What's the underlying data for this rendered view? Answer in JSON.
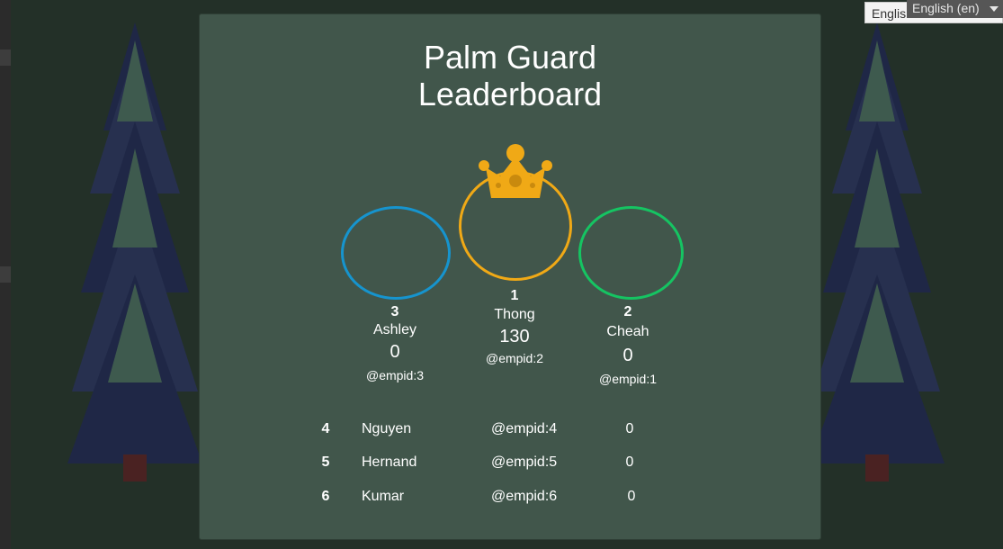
{
  "title": {
    "line1": "Palm Guard",
    "line2": "Leaderboard"
  },
  "podium": [
    {
      "rank": "1",
      "name": "Thong",
      "score": "130",
      "id": "@empid:2",
      "color": "#f0a916"
    },
    {
      "rank": "2",
      "name": "Cheah",
      "score": "0",
      "id": "@empid:1",
      "color": "#15c462"
    },
    {
      "rank": "3",
      "name": "Ashley",
      "score": "0",
      "id": "@empid:3",
      "color": "#1694ce"
    }
  ],
  "rows": [
    {
      "rank": "4",
      "name": "Nguyen",
      "id": "@empid:4",
      "score": "0"
    },
    {
      "rank": "5",
      "name": "Hernand",
      "id": "@empid:5",
      "score": "0"
    },
    {
      "rank": "6",
      "name": "Kumar",
      "id": "@empid:6",
      "score": "0"
    }
  ],
  "language": {
    "behind_label": "Englis",
    "selected": "English (en)"
  },
  "icons": {
    "crown": "crown-icon",
    "dropdown": "chevron-down-icon",
    "tree": "pine-tree-icon"
  },
  "colors": {
    "panel": "#41564b",
    "background": "#233028",
    "crown": "#f0a916"
  }
}
